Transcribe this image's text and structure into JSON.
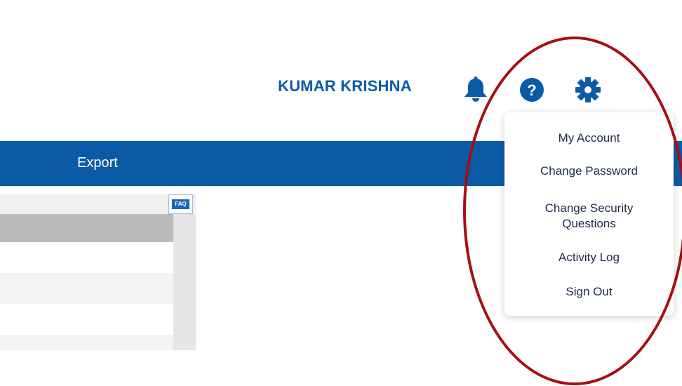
{
  "header": {
    "user_name": "KUMAR KRISHNA",
    "icons": [
      "bell-icon",
      "help-icon",
      "gear-icon"
    ],
    "accent_color": "#0b5aa6"
  },
  "navbar": {
    "items": [
      "Export"
    ],
    "background_color": "#0b5aa6"
  },
  "panel": {
    "faq_label": "FAQ"
  },
  "settings_menu": {
    "items": [
      "My Account",
      "Change Password",
      "Change Security Questions",
      "Activity Log",
      "Sign Out"
    ]
  },
  "annotation": {
    "color": "#a50f14"
  }
}
